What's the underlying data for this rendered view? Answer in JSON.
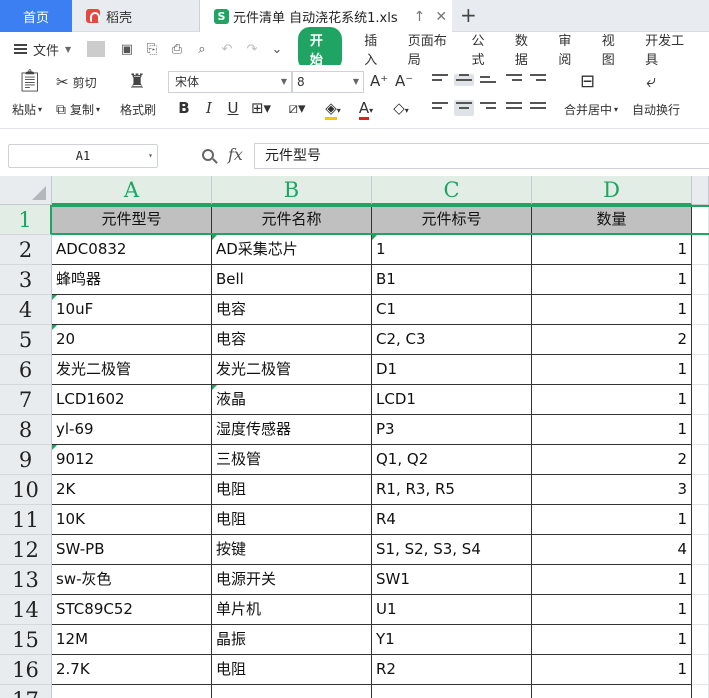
{
  "tabs": {
    "home": "首页",
    "daoke": "稻壳",
    "file": "元件清单 自动浇花系统1.xls"
  },
  "menu": {
    "file_label": "文件",
    "tabs": [
      "开始",
      "插入",
      "页面布局",
      "公式",
      "数据",
      "审阅",
      "视图",
      "开发工具"
    ],
    "active_tab": "开始"
  },
  "ribbon": {
    "paste": "粘贴",
    "cut": "剪切",
    "copy": "复制",
    "format_painter": "格式刷",
    "font_name": "宋体",
    "font_size": "8",
    "merge_center": "合并居中",
    "wrap_text": "自动换行"
  },
  "formula_bar": {
    "name_box": "A1",
    "fx": "fx",
    "content": "元件型号"
  },
  "sheet": {
    "columns": [
      "A",
      "B",
      "C",
      "D"
    ],
    "header": [
      "元件型号",
      "元件名称",
      "元件标号",
      "数量"
    ],
    "rows": [
      [
        "ADC0832",
        "AD采集芯片",
        "1",
        "1"
      ],
      [
        "蜂鸣器",
        "Bell",
        "B1",
        "1"
      ],
      [
        "10uF",
        "电容",
        "C1",
        "1"
      ],
      [
        "20",
        "电容",
        "C2, C3",
        "2"
      ],
      [
        "发光二极管",
        "发光二极管",
        "D1",
        "1"
      ],
      [
        "LCD1602",
        "液晶",
        "LCD1",
        "1"
      ],
      [
        "yl-69",
        "湿度传感器",
        "P3",
        "1"
      ],
      [
        "9012",
        "三极管",
        "Q1, Q2",
        "2"
      ],
      [
        "2K",
        "电阻",
        "R1, R3, R5",
        "3"
      ],
      [
        "10K",
        "电阻",
        "R4",
        "1"
      ],
      [
        "SW-PB",
        "按键",
        "S1, S2, S3, S4",
        "4"
      ],
      [
        "sw-灰色",
        "电源开关",
        "SW1",
        "1"
      ],
      [
        "STC89C52",
        "单片机",
        "U1",
        "1"
      ],
      [
        "12M",
        "晶振",
        "Y1",
        "1"
      ],
      [
        "2.7K",
        "电阻",
        "R2",
        "1"
      ]
    ],
    "row_numbers": [
      "1",
      "2",
      "3",
      "4",
      "5",
      "6",
      "7",
      "8",
      "9",
      "10",
      "11",
      "12",
      "13",
      "14",
      "15",
      "16",
      "17"
    ]
  },
  "colors": {
    "accent": "#1fa463",
    "tab_home": "#3b7ff2",
    "header_fill": "#c0c0c0"
  }
}
